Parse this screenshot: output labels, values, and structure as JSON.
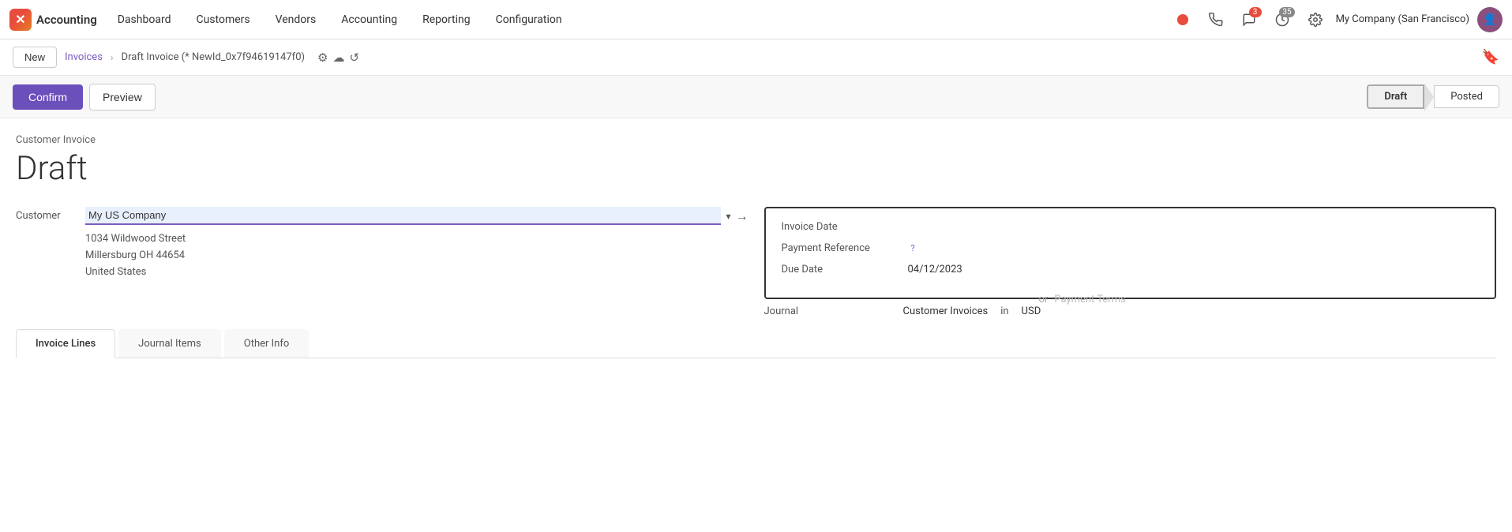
{
  "topnav": {
    "logo_icon": "✗",
    "app_name": "Accounting",
    "nav_items": [
      "Dashboard",
      "Customers",
      "Vendors",
      "Accounting",
      "Reporting",
      "Configuration"
    ],
    "notification_count": "3",
    "timer_count": "35",
    "company_name": "My Company (San Francisco)"
  },
  "breadcrumb": {
    "new_label": "New",
    "link": "Invoices",
    "current": "Draft Invoice (* NewId_0x7f94619147f0)"
  },
  "action_bar": {
    "confirm_label": "Confirm",
    "preview_label": "Preview",
    "status_steps": [
      "Draft",
      "Posted"
    ]
  },
  "form": {
    "invoice_label": "Customer Invoice",
    "invoice_title": "Draft",
    "customer_label": "Customer",
    "customer_value": "My US Company",
    "address_line1": "1034 Wildwood Street",
    "address_line2": "Millersburg OH 44654",
    "address_line3": "United States",
    "invoice_date_label": "Invoice Date",
    "payment_reference_label": "Payment Reference",
    "due_date_label": "Due Date",
    "due_date_value": "04/12/2023",
    "or_text": "or",
    "payment_terms_placeholder": "Payment Terms",
    "journal_label": "Journal",
    "journal_value": "Customer Invoices",
    "in_text": "in",
    "currency": "USD"
  },
  "tabs": {
    "items": [
      "Invoice Lines",
      "Journal Items",
      "Other Info"
    ],
    "active": "Invoice Lines"
  }
}
